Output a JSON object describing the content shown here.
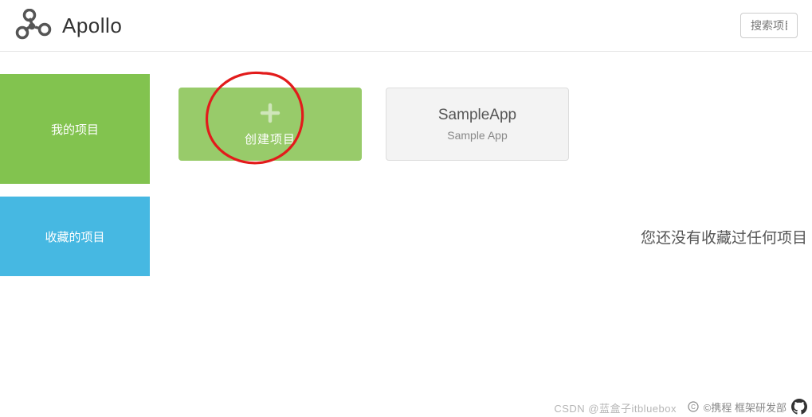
{
  "brand": {
    "name": "Apollo"
  },
  "search": {
    "placeholder": "搜索项目"
  },
  "sections": {
    "my_projects": {
      "label": "我的项目"
    },
    "favorites": {
      "label": "收藏的项目",
      "empty_text": "您还没有收藏过任何项目"
    }
  },
  "create_card": {
    "label": "创建项目"
  },
  "apps": [
    {
      "name": "SampleApp",
      "desc": "Sample App"
    }
  ],
  "footer": {
    "copyright": "©携程 框架研发部"
  },
  "watermark": "CSDN @蓝盒子itbluebox"
}
